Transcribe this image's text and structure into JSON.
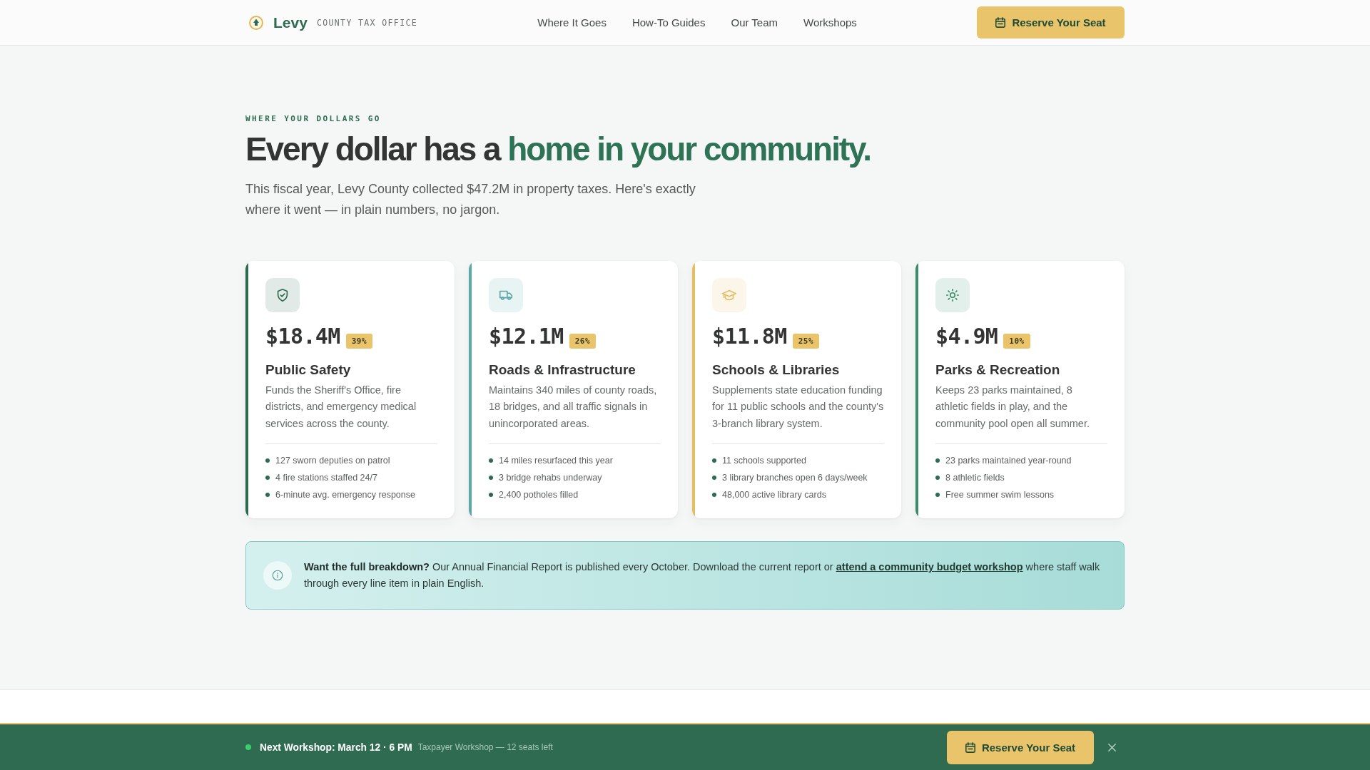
{
  "header": {
    "brand": "Levy",
    "tagline": "COUNTY TAX OFFICE",
    "nav": [
      {
        "label": "Where It Goes"
      },
      {
        "label": "How-To Guides"
      },
      {
        "label": "Our Team"
      },
      {
        "label": "Workshops"
      }
    ],
    "cta": "Reserve Your Seat"
  },
  "hero": {
    "eyebrow": "WHERE YOUR DOLLARS GO",
    "headline": "Every dollar has a",
    "headline_accent": "home in your community.",
    "intro": "This fiscal year, Levy County collected $47.2M in property taxes. Here's exactly where it went — in plain numbers, no jargon."
  },
  "categories": [
    {
      "kind": "safety",
      "color": "#2d6a4f",
      "amount": "$18.4M",
      "share": "39%",
      "title": "Public Safety",
      "description": "Funds the Sheriff's Office, fire districts, and emergency medical services across the county.",
      "facts": [
        "127 sworn deputies on patrol",
        "4 fire stations staffed 24/7",
        "6-minute avg. emergency response"
      ]
    },
    {
      "kind": "roads",
      "color": "#5ba8a8",
      "amount": "$12.1M",
      "share": "26%",
      "title": "Roads & Infrastructure",
      "description": "Maintains 340 miles of county roads, 18 bridges, and all traffic signals in unincorporated areas.",
      "facts": [
        "14 miles resurfaced this year",
        "3 bridge rehabs underway",
        "2,400 potholes filled"
      ]
    },
    {
      "kind": "schools",
      "color": "#e6be62",
      "amount": "$11.8M",
      "share": "25%",
      "title": "Schools & Libraries",
      "description": "Supplements state education funding for 11 public schools and the county's 3-branch library system.",
      "facts": [
        "11 schools supported",
        "3 library branches open 6 days/week",
        "48,000 active library cards"
      ]
    },
    {
      "kind": "parks",
      "color": "#3b8c68",
      "amount": "$4.9M",
      "share": "10%",
      "title": "Parks & Recreation",
      "description": "Keeps 23 parks maintained, 8 athletic fields in play, and the community pool open all summer.",
      "facts": [
        "23 parks maintained year-round",
        "8 athletic fields",
        "Free summer swim lessons"
      ]
    }
  ],
  "notice": {
    "text": "**Want the full breakdown?** Our Annual Financial Report is published every October. Download the current report or",
    "link": "attend a community budget workshop",
    "text_after": "where staff walk through every line item in plain English."
  },
  "workshop_bar": {
    "title": "Next Workshop: March 12 · 6 PM",
    "detail": "Taxpayer Workshop — 12 seats left",
    "cta": "Reserve Your Seat"
  }
}
